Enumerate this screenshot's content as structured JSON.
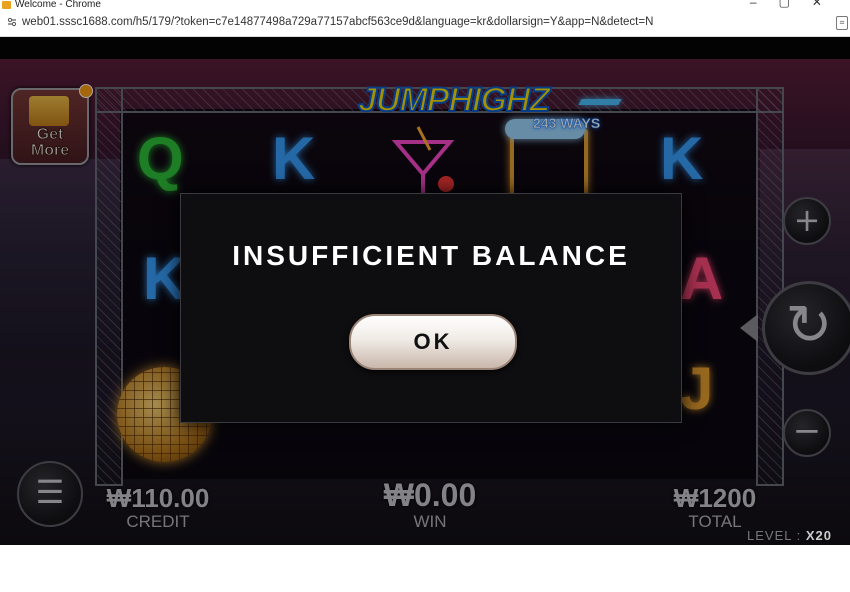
{
  "window": {
    "title": "Welcome - Chrome"
  },
  "browser": {
    "url": "web01.sssc1688.com/h5/179/?token=c7e14877498a729a77157abcf563ce9d&language=kr&dollarsign=Y&app=N&detect=N"
  },
  "game": {
    "logo": {
      "title": "JUMPHIGHZ",
      "ways": "243 WAYS"
    },
    "get_more": {
      "line1": "Get",
      "line2": "More"
    },
    "symbols": {
      "q": "Q",
      "k": "K",
      "a": "A",
      "j": "J"
    },
    "buttons": {
      "plus": "+",
      "minus": "−",
      "spin": "↻",
      "menu": "☰"
    },
    "credit": {
      "value": "₩110.00",
      "label": "CREDIT"
    },
    "win": {
      "value": "₩0.00",
      "label": "WIN"
    },
    "total": {
      "value": "₩1200",
      "label": "TOTAL"
    },
    "level": {
      "label": "LEVEL :",
      "value": "X20"
    }
  },
  "dialog": {
    "title": "INSUFFICIENT BALANCE",
    "ok_label": "OK"
  },
  "colors": {
    "logo_yellow": "#ffe100",
    "logo_blue": "#0d5fd0",
    "dialog_bg": "#0e0e10",
    "ok_button": "#f0ebe6"
  }
}
